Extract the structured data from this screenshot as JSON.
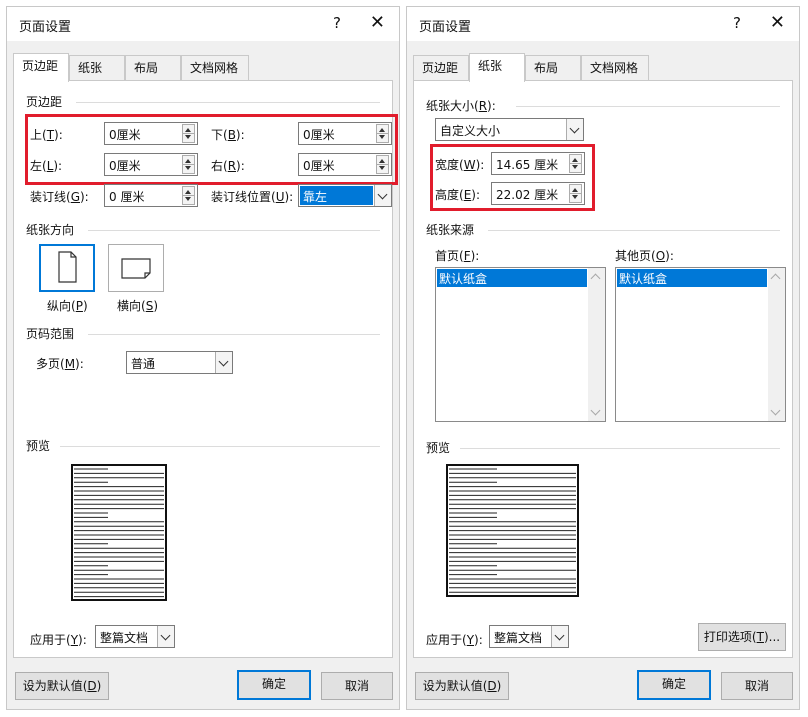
{
  "left_dialog": {
    "title": "页面设置",
    "help": "?",
    "close": "✕",
    "tabs": [
      "页边距",
      "纸张",
      "布局",
      "文档网格"
    ],
    "margins_group": "页边距",
    "top_label": "上(",
    "top_key": "T",
    "top_end": "):",
    "top_value": "0厘米",
    "bottom_label": "下(",
    "bottom_key": "B",
    "bottom_end": "):",
    "bottom_value": "0厘米",
    "left_label": "左(",
    "left_key": "L",
    "left_end": "):",
    "left_value": "0厘米",
    "right_label": "右(",
    "right_key": "R",
    "right_end": "):",
    "right_value": "0厘米",
    "gutter_label": "装订线(",
    "gutter_key": "G",
    "gutter_end": "):",
    "gutter_value": "0 厘米",
    "gutter_pos_label": "装订线位置(",
    "gutter_pos_key": "U",
    "gutter_pos_end": "):",
    "gutter_pos_value": "靠左",
    "orientation_group": "纸张方向",
    "portrait_label": "纵向(",
    "portrait_key": "P",
    "portrait_end": ")",
    "landscape_label": "横向(",
    "landscape_key": "S",
    "landscape_end": ")",
    "pages_group": "页码范围",
    "multi_label": "多页(",
    "multi_key": "M",
    "multi_end": "):",
    "multi_value": "普通",
    "preview_group": "预览",
    "apply_label": "应用于(",
    "apply_key": "Y",
    "apply_end": "):",
    "apply_value": "整篇文档",
    "default_btn": "设为默认值(",
    "default_key": "D",
    "default_end": ")",
    "ok_btn": "确定",
    "cancel_btn": "取消"
  },
  "right_dialog": {
    "title": "页面设置",
    "help": "?",
    "close": "✕",
    "tabs": [
      "页边距",
      "纸张",
      "布局",
      "文档网格"
    ],
    "size_group": "纸张大小(",
    "size_key": "R",
    "size_end": "):",
    "size_value": "自定义大小",
    "width_label": "宽度(",
    "width_key": "W",
    "width_end": "):",
    "width_value": "14.65 厘米",
    "height_label": "高度(",
    "height_key": "E",
    "height_end": "):",
    "height_value": "22.02 厘米",
    "source_group": "纸张来源",
    "first_label": "首页(",
    "first_key": "F",
    "first_end": "):",
    "first_item": "默认纸盒",
    "other_label": "其他页(",
    "other_key": "O",
    "other_end": "):",
    "other_item": "默认纸盒",
    "preview_group": "预览",
    "apply_label": "应用于(",
    "apply_key": "Y",
    "apply_end": "):",
    "apply_value": "整篇文档",
    "print_btn": "打印选项(",
    "print_key": "T",
    "print_end": ")...",
    "default_btn": "设为默认值(",
    "default_key": "D",
    "default_end": ")",
    "ok_btn": "确定",
    "cancel_btn": "取消"
  },
  "colors": {
    "highlight_box": "#e11c2c",
    "selection": "#0078d7"
  }
}
